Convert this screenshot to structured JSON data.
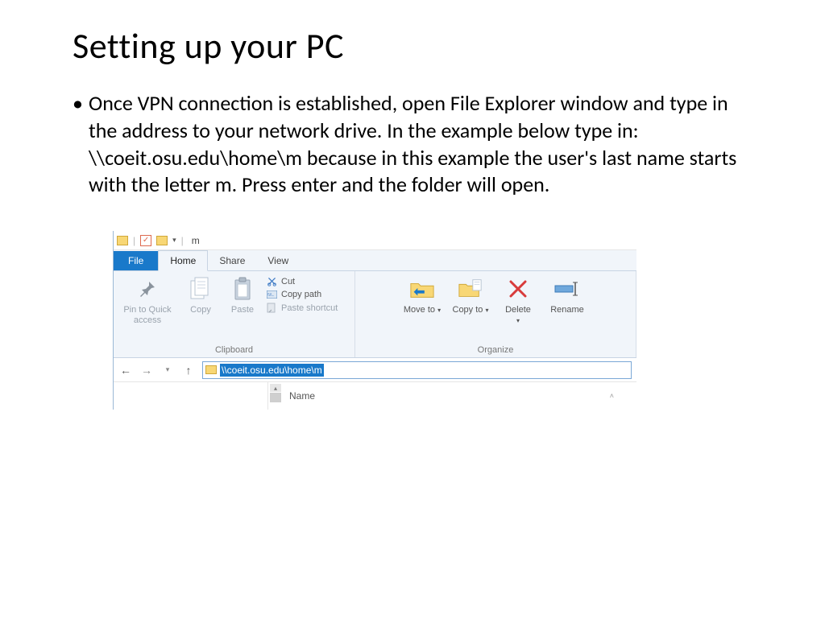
{
  "slide": {
    "title": "Setting up your PC",
    "bullet": "Once VPN connection is established, open File Explorer window and type in the address to your network drive. In the example below type in: \\\\coeit.osu.edu\\home\\m  because in this example the user's last name starts with the letter m. Press enter and the folder will open."
  },
  "explorer": {
    "window_title": "m",
    "tabs": {
      "file": "File",
      "home": "Home",
      "share": "Share",
      "view": "View"
    },
    "ribbon": {
      "pin": "Pin to Quick access",
      "copy": "Copy",
      "paste": "Paste",
      "cut": "Cut",
      "copy_path": "Copy path",
      "paste_shortcut": "Paste shortcut",
      "clipboard_group": "Clipboard",
      "move_to": "Move to",
      "copy_to": "Copy to",
      "delete": "Delete",
      "rename": "Rename",
      "organize_group": "Organize"
    },
    "address": "\\\\coeit.osu.edu\\home\\m",
    "columns": {
      "name": "Name"
    }
  }
}
